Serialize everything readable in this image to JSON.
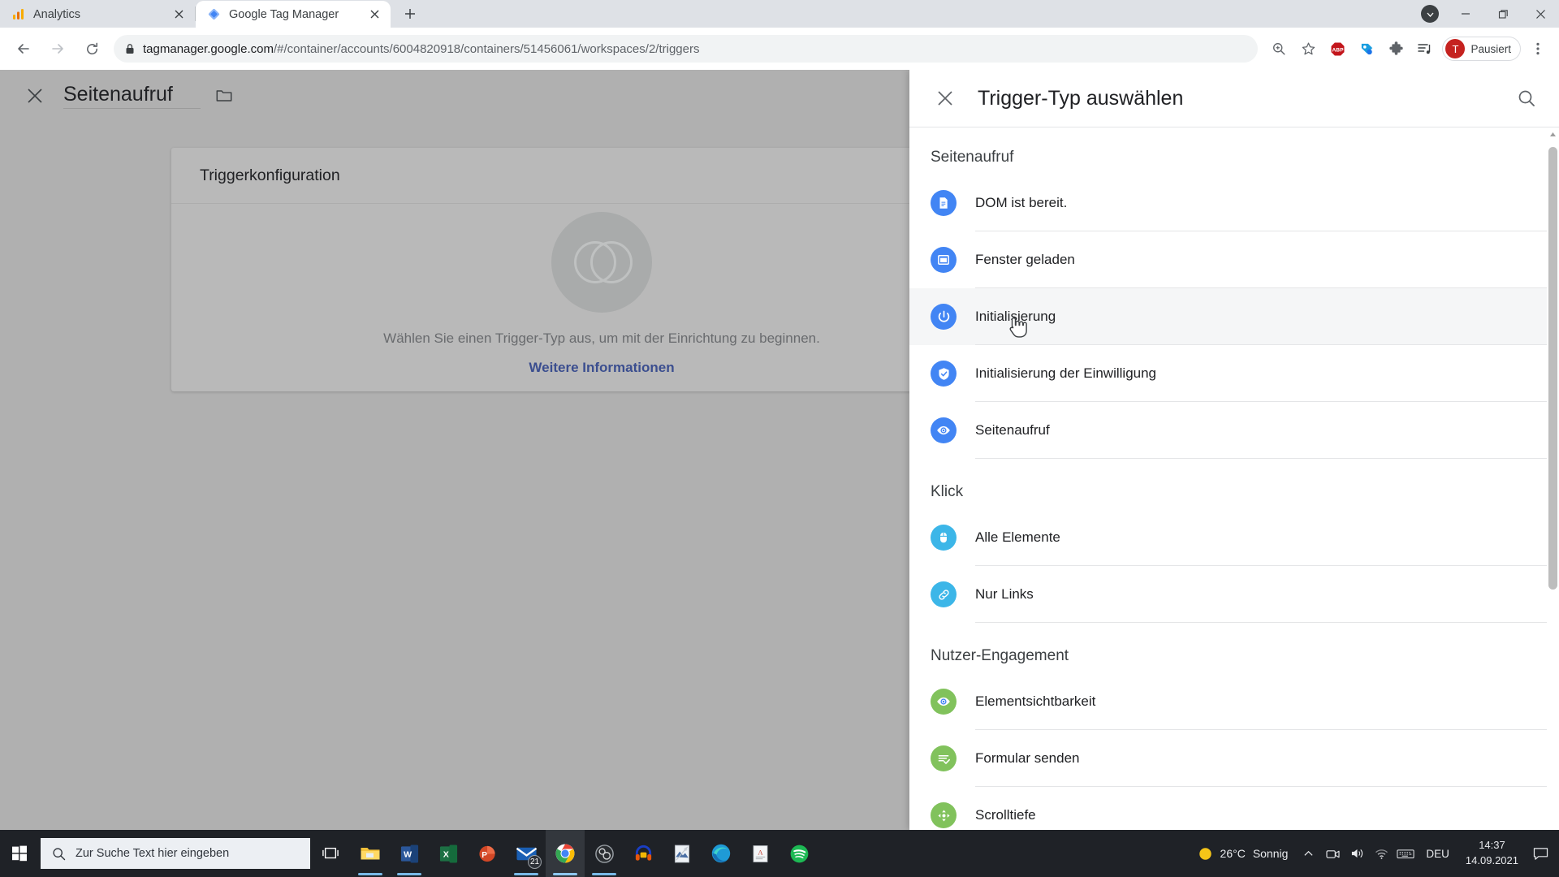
{
  "browser": {
    "tabs": [
      {
        "title": "Analytics",
        "favicon": "analytics-icon",
        "active": false
      },
      {
        "title": "Google Tag Manager",
        "favicon": "tag-manager-icon",
        "active": true
      }
    ],
    "newtab_label": "+",
    "window_controls": {
      "minimize": "—",
      "maximize": "❐",
      "close": "✕"
    },
    "nav": {
      "back": "back-arrow-icon",
      "forward": "forward-arrow-icon",
      "reload": "reload-icon"
    },
    "omnibox": {
      "lock": "lock-icon",
      "host": "tagmanager.google.com",
      "path": "/#/container/accounts/6004820918/containers/51456061/workspaces/2/triggers",
      "full_url": "tagmanager.google.com/#/container/accounts/6004820918/containers/51456061/workspaces/2/triggers"
    },
    "toolbar_icons": [
      "zoom-in-icon",
      "bookmark-star-icon",
      "adblock-plus-icon",
      "tag-assistant-icon",
      "extensions-puzzle-icon",
      "media-playlist-icon"
    ],
    "profile": {
      "initial": "T",
      "label": "Pausiert",
      "avatar_color": "#c5221f"
    },
    "menu": "three-dot-menu-icon"
  },
  "background": {
    "close_label": "✕",
    "title": "Seitenaufruf",
    "folder_icon": "folder-icon",
    "card": {
      "heading": "Triggerkonfiguration",
      "empty_text": "Wählen Sie einen Trigger-Typ aus, um mit der Einrichtung zu beginnen.",
      "link_text": "Weitere Informationen"
    }
  },
  "panel": {
    "close_label": "✕",
    "title": "Trigger-Typ auswählen",
    "search_icon": "search-icon",
    "groups": [
      {
        "title": "Seitenaufruf",
        "color": "#4285f4",
        "items": [
          {
            "label": "DOM ist bereit.",
            "icon": "document-icon",
            "hovered": false
          },
          {
            "label": "Fenster geladen",
            "icon": "window-icon",
            "hovered": false
          },
          {
            "label": "Initialisierung",
            "icon": "power-icon",
            "hovered": true
          },
          {
            "label": "Initialisierung der Einwilligung",
            "icon": "shield-check-icon",
            "hovered": false
          },
          {
            "label": "Seitenaufruf",
            "icon": "eye-icon",
            "hovered": false
          }
        ]
      },
      {
        "title": "Klick",
        "color": "#3cb6e8",
        "items": [
          {
            "label": "Alle Elemente",
            "icon": "mouse-icon",
            "hovered": false
          },
          {
            "label": "Nur Links",
            "icon": "link-icon",
            "hovered": false
          }
        ]
      },
      {
        "title": "Nutzer-Engagement",
        "color": "#81c25c",
        "items": [
          {
            "label": "Elementsichtbarkeit",
            "icon": "eye-icon",
            "hovered": false
          },
          {
            "label": "Formular senden",
            "icon": "form-check-icon",
            "hovered": false
          },
          {
            "label": "Scrolltiefe",
            "icon": "scroll-arrows-icon",
            "hovered": false
          }
        ]
      }
    ]
  },
  "taskbar": {
    "start_icon": "windows-start-icon",
    "search_placeholder": "Zur Suche Text hier eingeben",
    "search_icon": "search-icon",
    "taskview_icon": "task-view-icon",
    "apps": [
      {
        "name": "file-explorer",
        "open": true
      },
      {
        "name": "word",
        "open": true
      },
      {
        "name": "excel",
        "open": false
      },
      {
        "name": "powerpoint",
        "open": false
      },
      {
        "name": "mail",
        "open": true,
        "badge": "21"
      },
      {
        "name": "chrome",
        "open": true,
        "active": true
      },
      {
        "name": "obs-studio",
        "open": true
      },
      {
        "name": "headphones-app",
        "open": false
      },
      {
        "name": "photo-app",
        "open": false
      },
      {
        "name": "edge",
        "open": false
      },
      {
        "name": "notes-app",
        "open": false
      },
      {
        "name": "spotify",
        "open": false
      }
    ],
    "tray": {
      "weather_icon": "sun-icon",
      "temperature": "26°C",
      "condition": "Sonnig",
      "chevron": "chevron-up-icon",
      "icons": [
        "camera-icon",
        "volume-icon",
        "wifi-icon",
        "keyboard-icon"
      ],
      "language": "DEU",
      "time": "14:37",
      "date": "14.09.2021",
      "notification_icon": "notification-icon"
    }
  }
}
